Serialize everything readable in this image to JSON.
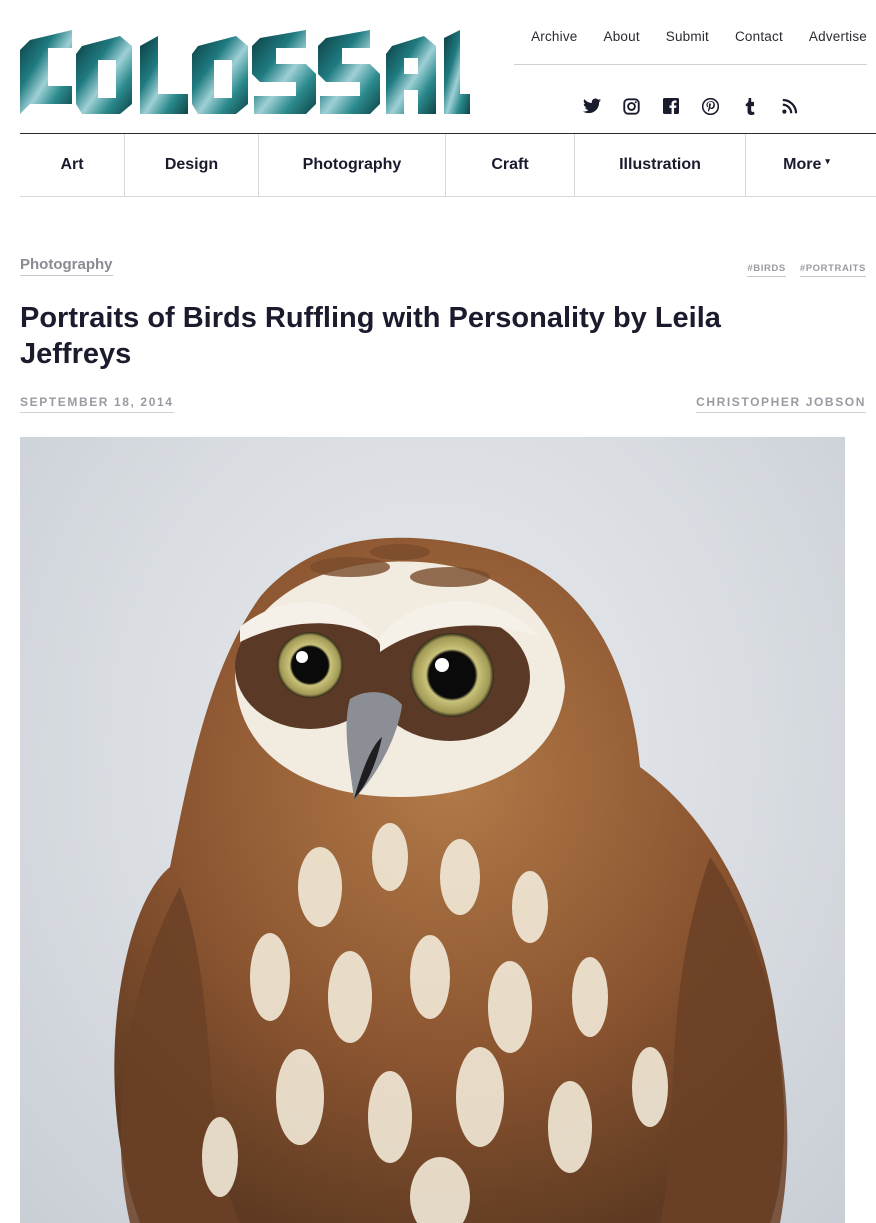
{
  "site": {
    "name": "COLOSSAL",
    "colors": {
      "logo_dark": "#0e4a4e",
      "logo_light": "#b9d9df",
      "text": "#1b1b2e",
      "muted": "#9a9aa2"
    }
  },
  "top_links": [
    "Archive",
    "About",
    "Submit",
    "Contact",
    "Advertise"
  ],
  "social_icons": [
    "twitter-icon",
    "instagram-icon",
    "facebook-icon",
    "pinterest-icon",
    "tumblr-icon",
    "rss-icon"
  ],
  "nav": {
    "items": [
      "Art",
      "Design",
      "Photography",
      "Craft",
      "Illustration",
      "More"
    ],
    "more_caret": "▾"
  },
  "article": {
    "category": "Photography",
    "tags": [
      "#BIRDS",
      "#PORTRAITS"
    ],
    "title": "Portraits of Birds Ruffling with Personality by Leila Jeffreys",
    "date": "SEPTEMBER 18, 2014",
    "author": "CHRISTOPHER JOBSON",
    "image": {
      "subject": "owl-portrait",
      "background": "#dde1e5"
    }
  }
}
